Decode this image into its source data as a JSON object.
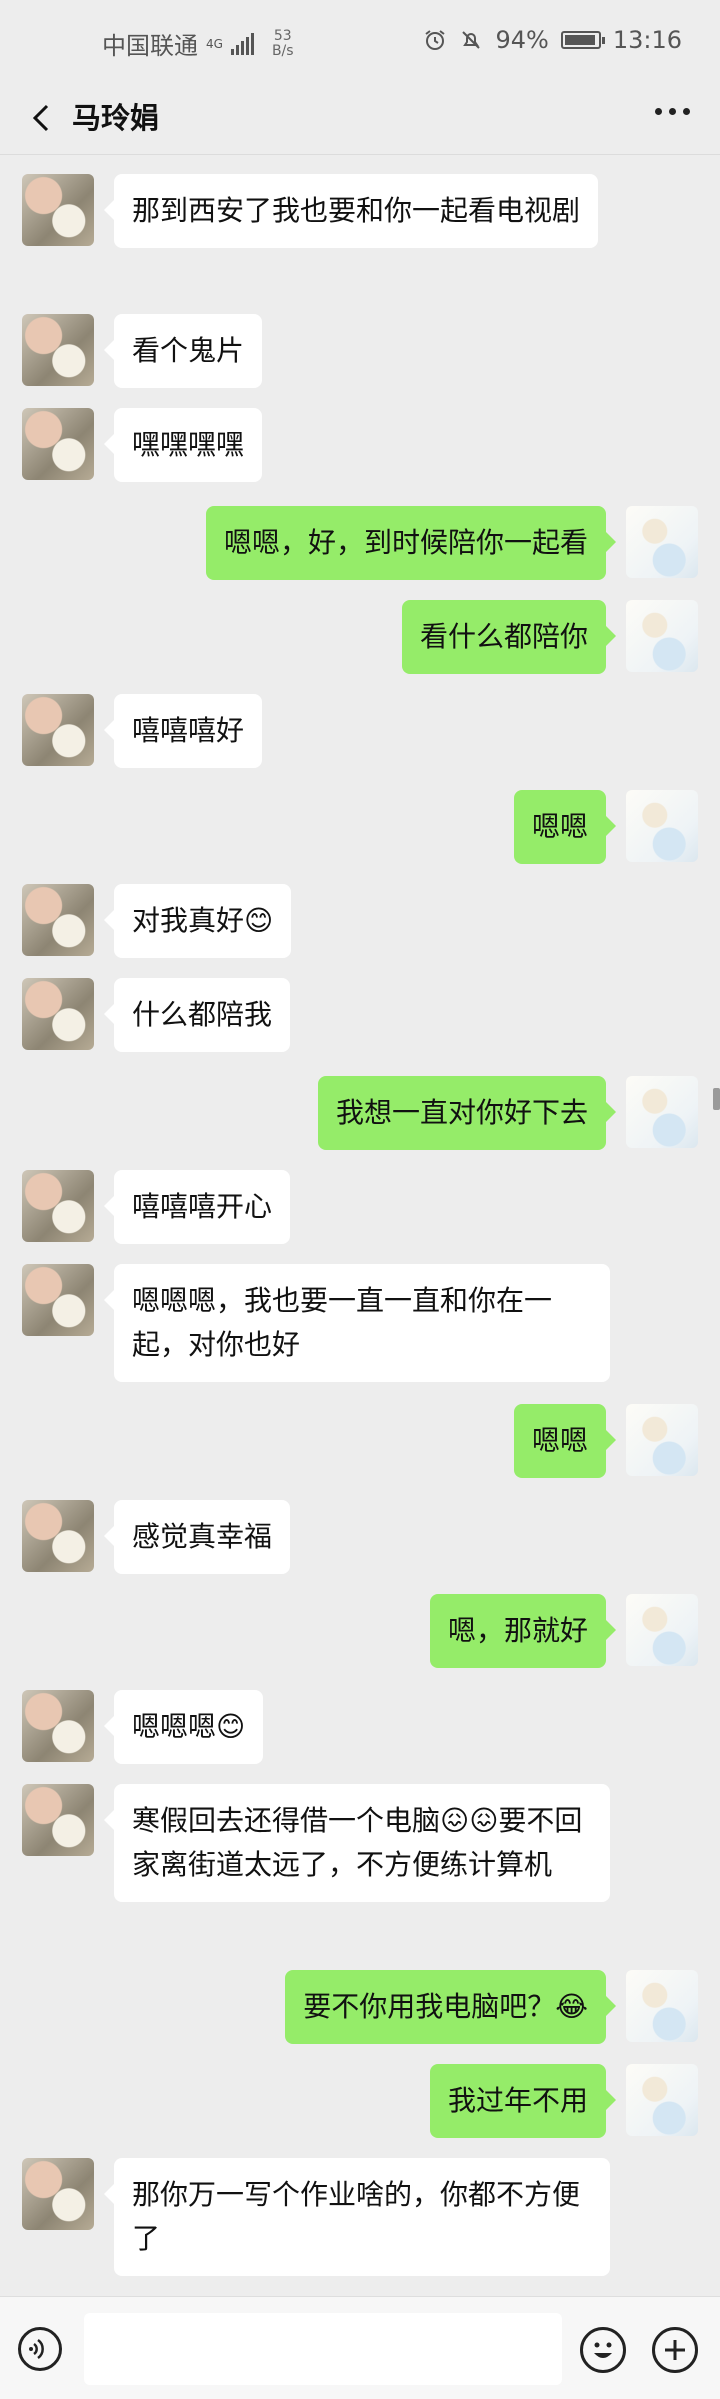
{
  "status_bar": {
    "carrier": "中国联通",
    "network_type": "4G",
    "net_speed_value": "53",
    "net_speed_unit": "B/s",
    "battery": "94%",
    "time": "13:16"
  },
  "chat": {
    "title": "马玲娟"
  },
  "messages": [
    {
      "side": "left",
      "text": "那到西安了我也要和你一起看电视剧"
    },
    {
      "side": "left",
      "text": "看个鬼片"
    },
    {
      "side": "left",
      "text": "嘿嘿嘿嘿"
    },
    {
      "side": "right",
      "text": "嗯嗯，好，到时候陪你一起看"
    },
    {
      "side": "right",
      "text": "看什么都陪你"
    },
    {
      "side": "left",
      "text": "嘻嘻嘻好"
    },
    {
      "side": "right",
      "text": "嗯嗯"
    },
    {
      "side": "left",
      "text": "对我真好😊"
    },
    {
      "side": "left",
      "text": "什么都陪我"
    },
    {
      "side": "right",
      "text": "我想一直对你好下去"
    },
    {
      "side": "left",
      "text": "嘻嘻嘻开心"
    },
    {
      "side": "left",
      "text": "嗯嗯嗯，我也要一直一直和你在一起，对你也好"
    },
    {
      "side": "right",
      "text": "嗯嗯"
    },
    {
      "side": "left",
      "text": "感觉真幸福"
    },
    {
      "side": "right",
      "text": "嗯，那就好"
    },
    {
      "side": "left",
      "text": "嗯嗯嗯😊"
    },
    {
      "side": "left",
      "text": "寒假回去还得借一个电脑😖😖要不回家离街道太远了，不方便练计算机"
    },
    {
      "side": "right",
      "text": "要不你用我电脑吧？😂"
    },
    {
      "side": "right",
      "text": "我过年不用"
    },
    {
      "side": "left",
      "text": "那你万一写个作业啥的，你都不方便了"
    }
  ],
  "input_bar": {
    "placeholder": ""
  },
  "icons": {
    "back": "chevron-left-icon",
    "more": "more-dots-icon",
    "voice": "voice-icon",
    "emoji": "emoji-icon",
    "add": "plus-icon"
  },
  "colors": {
    "sent_bubble": "#95ec69",
    "received_bubble": "#ffffff",
    "background": "#ededed"
  }
}
